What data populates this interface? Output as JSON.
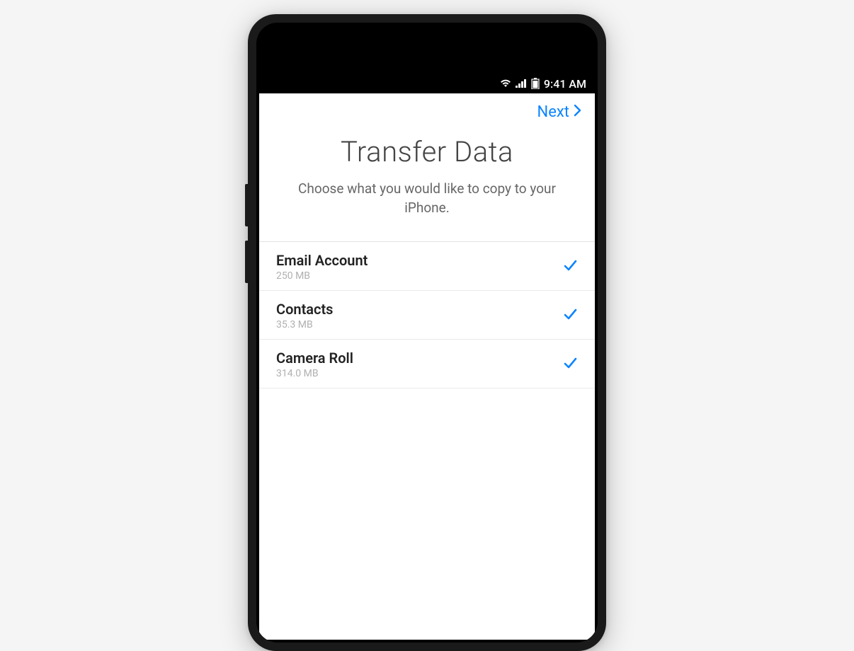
{
  "status_bar": {
    "time": "9:41 AM"
  },
  "nav": {
    "next_label": "Next"
  },
  "header": {
    "title": "Transfer Data",
    "subtitle": "Choose what you would like to copy to your iPhone."
  },
  "items": [
    {
      "label": "Email Account",
      "size": "250 MB",
      "checked": true
    },
    {
      "label": "Contacts",
      "size": "35.3 MB",
      "checked": true
    },
    {
      "label": "Camera Roll",
      "size": "314.0 MB",
      "checked": true
    }
  ],
  "colors": {
    "accent": "#0b84ff"
  }
}
